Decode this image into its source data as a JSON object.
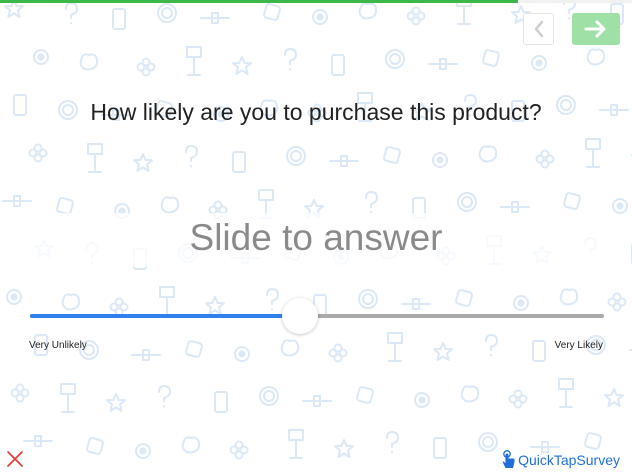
{
  "progress": {
    "value": 0.82,
    "color": "#3cb84a"
  },
  "nav": {
    "back": {
      "icon": "chevron-left-icon"
    },
    "next": {
      "icon": "arrow-right-icon",
      "color": "#9fe0a6"
    }
  },
  "question": {
    "text": "How likely are you to purchase this product?"
  },
  "slider": {
    "prompt": "Slide to answer",
    "value": 0.47,
    "min_label": "Very Unlikely",
    "max_label": "Very Likely",
    "fill_color": "#2f80ed",
    "rest_color": "#a9a9a9"
  },
  "footer": {
    "close": {
      "icon": "close-icon",
      "color": "#e53935"
    },
    "brand": {
      "text": "QuickTapSurvey",
      "icon": "hand-tap-icon",
      "color": "#1e6fd9"
    }
  }
}
